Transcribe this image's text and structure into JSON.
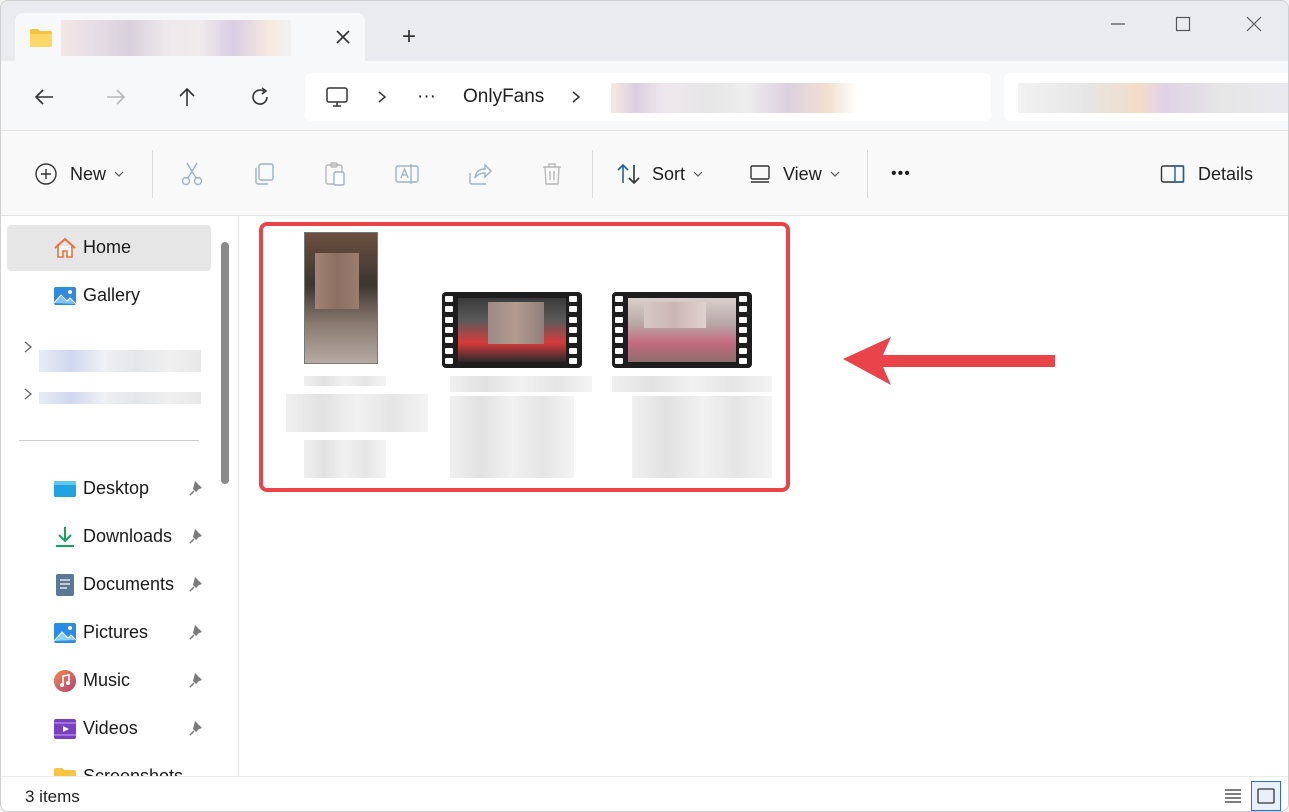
{
  "title_bar": {
    "tab_title": "",
    "new_tab_label": "+"
  },
  "address_bar": {
    "ellipsis": "···",
    "crumb_folder": "OnlyFans",
    "crumb_current": ""
  },
  "command_bar": {
    "new_label": "New",
    "sort_label": "Sort",
    "view_label": "View",
    "more_label": "•••",
    "details_label": "Details"
  },
  "sidebar": {
    "home_label": "Home",
    "gallery_label": "Gallery",
    "items": [
      {
        "label": "Desktop",
        "icon": "desktop-icon"
      },
      {
        "label": "Downloads",
        "icon": "downloads-icon"
      },
      {
        "label": "Documents",
        "icon": "documents-icon"
      },
      {
        "label": "Pictures",
        "icon": "pictures-icon"
      },
      {
        "label": "Music",
        "icon": "music-icon"
      },
      {
        "label": "Videos",
        "icon": "videos-icon"
      },
      {
        "label": "Screenshots",
        "icon": "screenshots-icon"
      }
    ]
  },
  "content": {
    "files": [
      {
        "type": "image",
        "name": ""
      },
      {
        "type": "video",
        "name": ""
      },
      {
        "type": "video",
        "name": ""
      }
    ],
    "highlight_color": "#e8444a"
  },
  "status_bar": {
    "item_count": "3 items"
  },
  "colors": {
    "accent": "#2a6fc9",
    "annotation": "#e8444a"
  }
}
